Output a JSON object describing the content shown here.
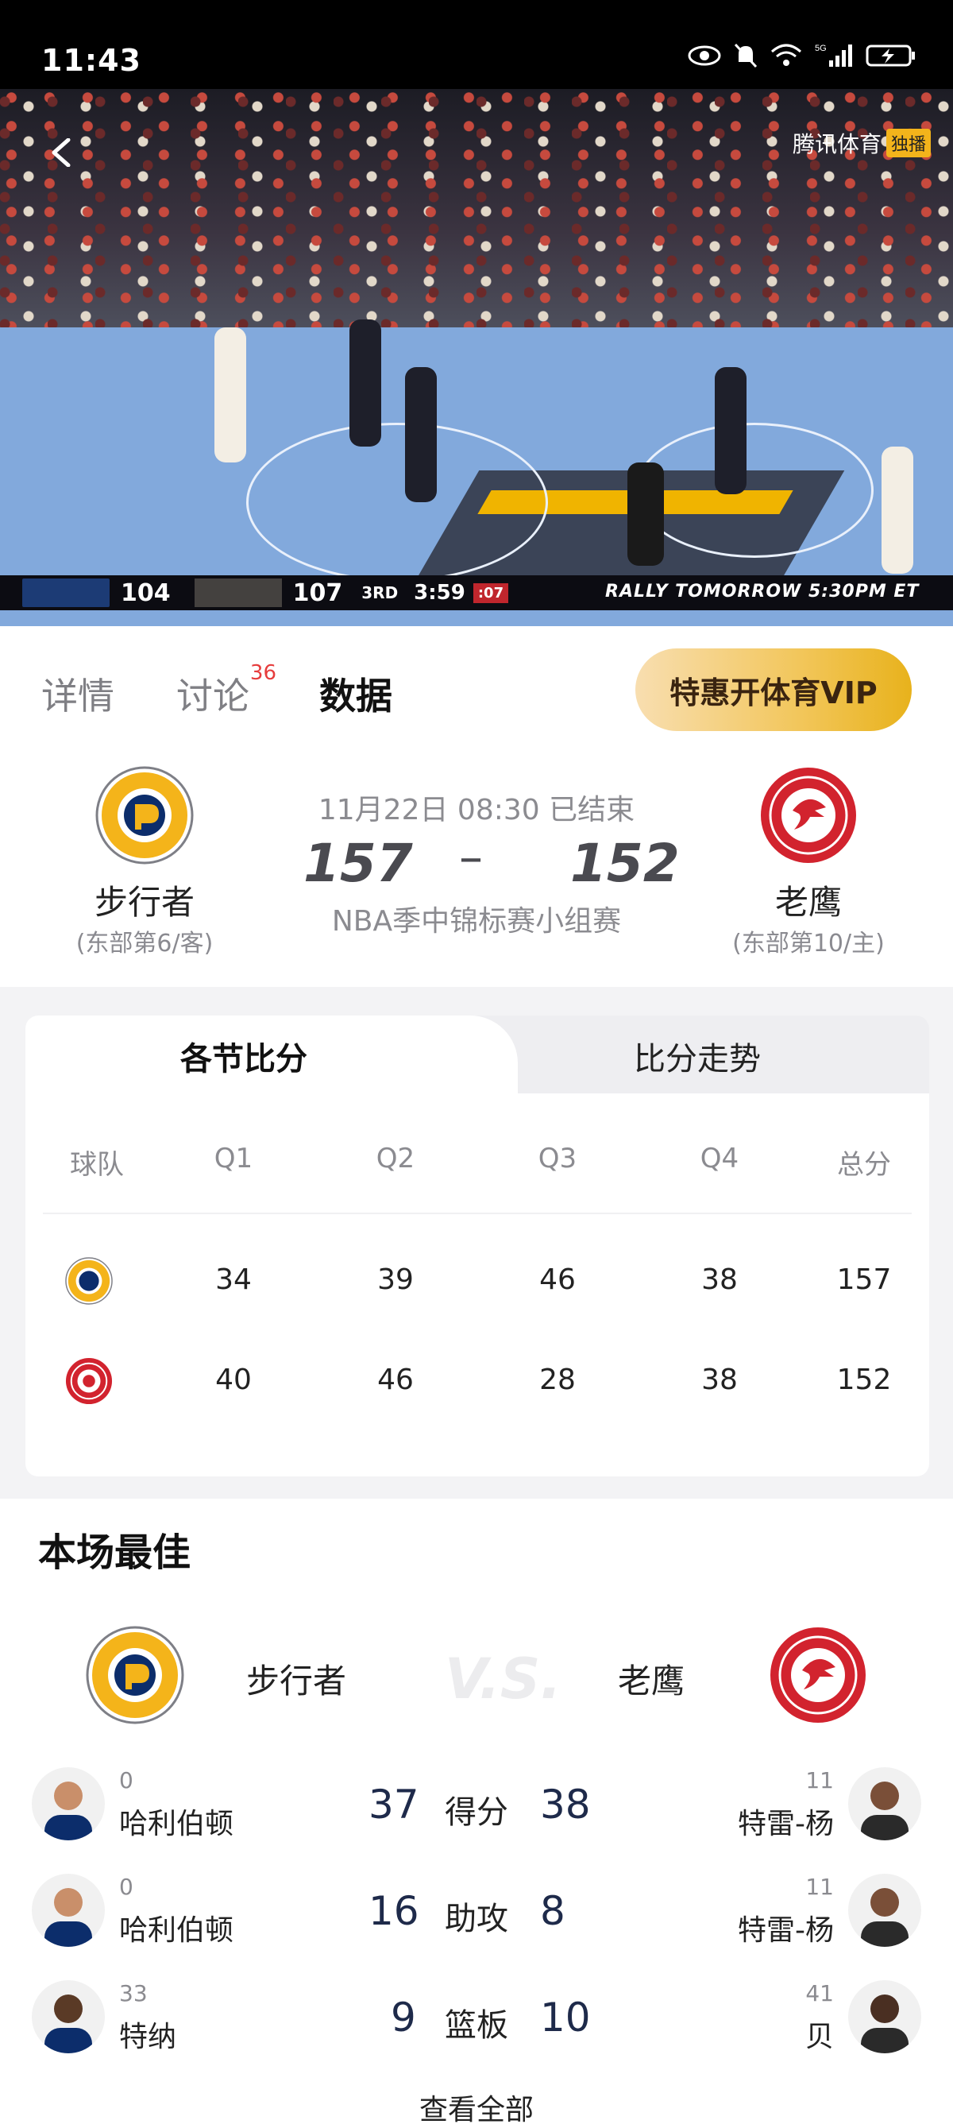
{
  "status_bar": {
    "time": "11:43"
  },
  "video": {
    "watermark": "腾讯体育",
    "watermark_tag": "独播",
    "scorebug": {
      "home_score": "104",
      "away_score": "107",
      "quarter": "3RD",
      "clock": "3:59",
      "shot_clock": ":07",
      "promo": "RALLY TOMORROW 5:30PM ET"
    }
  },
  "tabs": [
    {
      "label": "详情"
    },
    {
      "label": "讨论",
      "badge": "36"
    },
    {
      "label": "数据"
    }
  ],
  "vip_button": "特惠开体育VIP",
  "match": {
    "date_status": "11月22日 08:30 已结束",
    "league": "NBA季中锦标赛小组赛",
    "away": {
      "name": "步行者",
      "sub": "(东部第6/客)",
      "score": "157"
    },
    "home": {
      "name": "老鹰",
      "sub": "(东部第10/主)",
      "score": "152"
    },
    "dash": "–"
  },
  "quarter_card": {
    "tab_active": "各节比分",
    "tab_other": "比分走势",
    "headers": [
      "球队",
      "Q1",
      "Q2",
      "Q3",
      "Q4",
      "总分"
    ],
    "rows": [
      {
        "team": "步行者",
        "values": [
          "34",
          "39",
          "46",
          "38",
          "157"
        ]
      },
      {
        "team": "老鹰",
        "values": [
          "40",
          "46",
          "28",
          "38",
          "152"
        ]
      }
    ]
  },
  "best": {
    "title": "本场最佳",
    "left_team": "步行者",
    "right_team": "老鹰",
    "vs": "V.S.",
    "rows": [
      {
        "label": "得分",
        "left": {
          "num": "0",
          "name": "哈利伯顿",
          "value": "37"
        },
        "right": {
          "num": "11",
          "name": "特雷-杨",
          "value": "38"
        }
      },
      {
        "label": "助攻",
        "left": {
          "num": "0",
          "name": "哈利伯顿",
          "value": "16"
        },
        "right": {
          "num": "11",
          "name": "特雷-杨",
          "value": "8"
        }
      },
      {
        "label": "篮板",
        "left": {
          "num": "33",
          "name": "特纳",
          "value": "9"
        },
        "right": {
          "num": "41",
          "name": "贝",
          "value": "10"
        }
      }
    ],
    "more": "查看全部"
  },
  "colors": {
    "pacers_navy": "#0c2d6b",
    "pacers_gold": "#f4b41a",
    "hawks_red": "#d2232e",
    "vip_gold": "#f2c65a",
    "badge_red": "#e63c3c"
  }
}
